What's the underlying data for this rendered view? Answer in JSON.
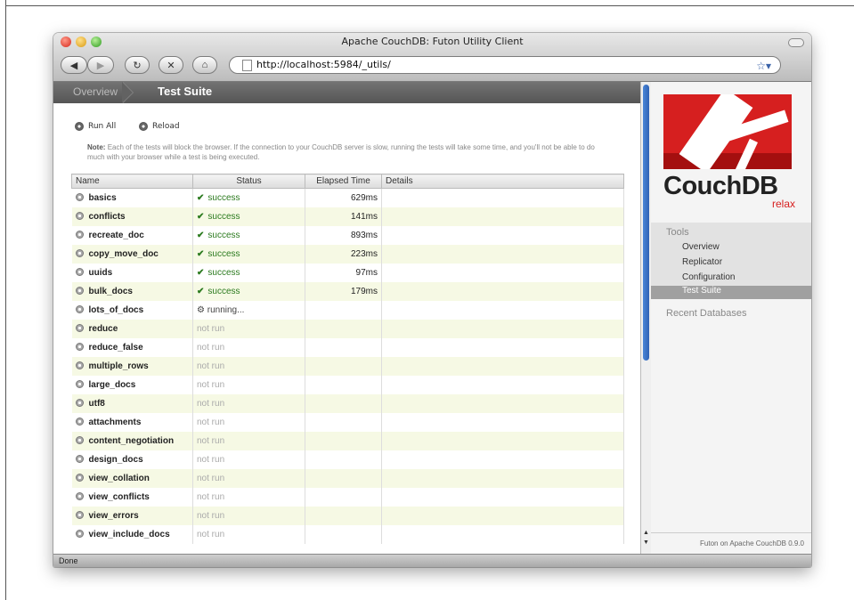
{
  "window": {
    "title": "Apache CouchDB: Futon Utility Client"
  },
  "toolbar": {
    "url": "http://localhost:5984/_utils/"
  },
  "tabs": {
    "overview": "Overview",
    "current": "Test Suite"
  },
  "actions": {
    "run_all": "Run All",
    "reload": "Reload"
  },
  "note": {
    "label": "Note:",
    "text": "Each of the tests will block the browser. If the connection to your CouchDB server is slow, running the tests will take some time, and you'll not be able to do much with your browser while a test is being executed."
  },
  "table": {
    "headers": [
      "Name",
      "Status",
      "Elapsed Time",
      "Details"
    ],
    "rows": [
      {
        "name": "basics",
        "status": "success",
        "time": "629ms"
      },
      {
        "name": "conflicts",
        "status": "success",
        "time": "141ms"
      },
      {
        "name": "recreate_doc",
        "status": "success",
        "time": "893ms"
      },
      {
        "name": "copy_move_doc",
        "status": "success",
        "time": "223ms"
      },
      {
        "name": "uuids",
        "status": "success",
        "time": "97ms"
      },
      {
        "name": "bulk_docs",
        "status": "success",
        "time": "179ms"
      },
      {
        "name": "lots_of_docs",
        "status": "running...",
        "time": ""
      },
      {
        "name": "reduce",
        "status": "not run",
        "time": ""
      },
      {
        "name": "reduce_false",
        "status": "not run",
        "time": ""
      },
      {
        "name": "multiple_rows",
        "status": "not run",
        "time": ""
      },
      {
        "name": "large_docs",
        "status": "not run",
        "time": ""
      },
      {
        "name": "utf8",
        "status": "not run",
        "time": ""
      },
      {
        "name": "attachments",
        "status": "not run",
        "time": ""
      },
      {
        "name": "content_negotiation",
        "status": "not run",
        "time": ""
      },
      {
        "name": "design_docs",
        "status": "not run",
        "time": ""
      },
      {
        "name": "view_collation",
        "status": "not run",
        "time": ""
      },
      {
        "name": "view_conflicts",
        "status": "not run",
        "time": ""
      },
      {
        "name": "view_errors",
        "status": "not run",
        "time": ""
      },
      {
        "name": "view_include_docs",
        "status": "not run",
        "time": ""
      }
    ]
  },
  "sidebar": {
    "logo_text": "CouchDB",
    "logo_tagline": "relax",
    "tools_heading": "Tools",
    "items": [
      "Overview",
      "Replicator",
      "Configuration",
      "Test Suite"
    ],
    "active_item": "Test Suite",
    "recent_heading": "Recent Databases",
    "footer": "Futon on Apache CouchDB 0.9.0"
  },
  "statusbar": {
    "text": "Done"
  },
  "colors": {
    "success": "#2b7a1e",
    "brand_red": "#d61f1f",
    "row_stripe": "#f6f9e4"
  },
  "icons": [
    "back-icon",
    "forward-icon",
    "reload-icon",
    "stop-icon",
    "home-icon",
    "page-icon",
    "bookmark-star-icon",
    "run-all-icon",
    "reload-tests-icon",
    "test-row-icon",
    "running-icon"
  ]
}
